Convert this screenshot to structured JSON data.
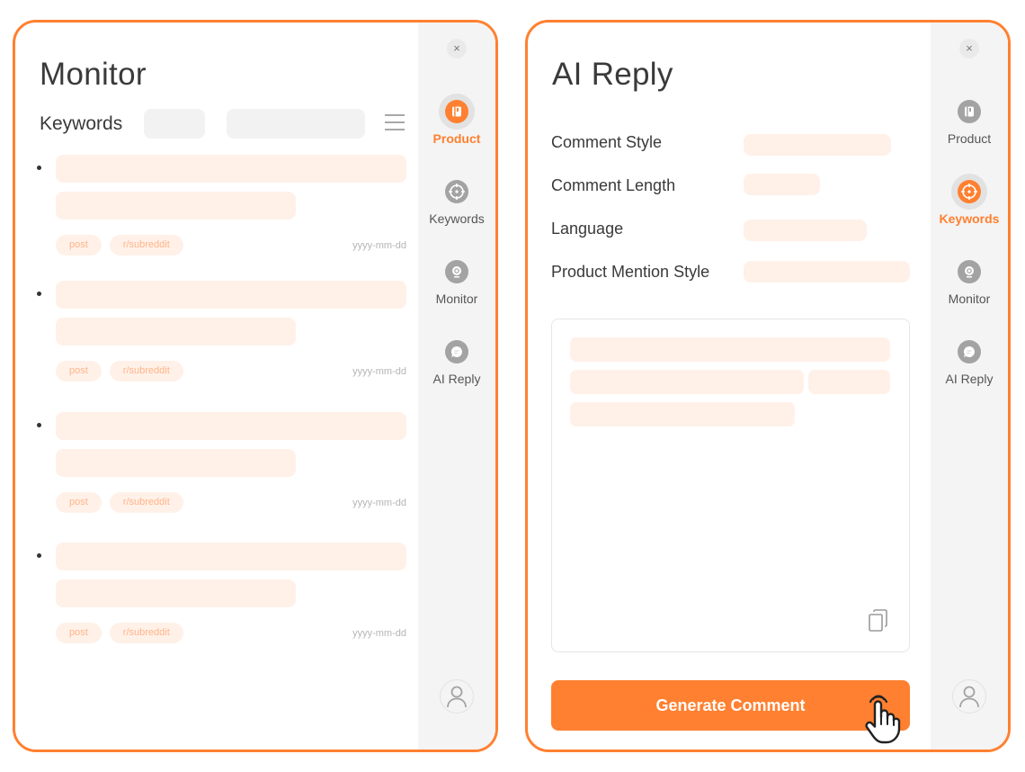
{
  "colors": {
    "accent": "#FF8030",
    "placeholder": "#FFF1E8",
    "sidebar_bg": "#F4F4F4",
    "icon_gray": "#A3A3A3"
  },
  "sidebar": {
    "close_label": "×",
    "items": [
      {
        "label": "Product",
        "icon": "product-book-icon"
      },
      {
        "label": "Keywords",
        "icon": "target-crosshair-icon"
      },
      {
        "label": "Monitor",
        "icon": "webcam-icon"
      },
      {
        "label": "AI Reply",
        "icon": "chat-bubble-icon"
      }
    ],
    "avatar_icon": "user-icon"
  },
  "monitor_panel": {
    "title": "Monitor",
    "active_nav": "Product",
    "keywords_label": "Keywords",
    "posts": [
      {
        "tag_type": "post",
        "tag_subreddit": "r/subreddit",
        "date": "yyyy-mm-dd"
      },
      {
        "tag_type": "post",
        "tag_subreddit": "r/subreddit",
        "date": "yyyy-mm-dd"
      },
      {
        "tag_type": "post",
        "tag_subreddit": "r/subreddit",
        "date": "yyyy-mm-dd"
      },
      {
        "tag_type": "post",
        "tag_subreddit": "r/subreddit",
        "date": "yyyy-mm-dd"
      }
    ]
  },
  "ai_reply_panel": {
    "title": "AI Reply",
    "active_nav": "Keywords",
    "fields": [
      {
        "label": "Comment Style"
      },
      {
        "label": "Comment Length"
      },
      {
        "label": "Language"
      },
      {
        "label": "Product Mention Style"
      }
    ],
    "generate_button": "Generate Comment"
  }
}
